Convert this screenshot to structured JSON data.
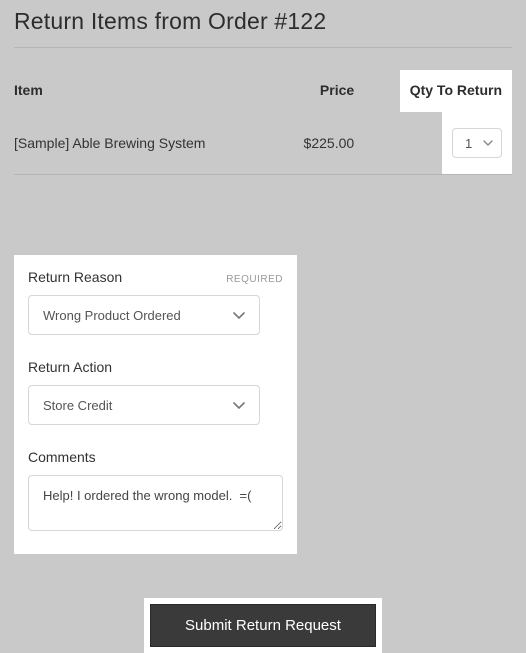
{
  "page": {
    "title": "Return Items from Order #122"
  },
  "table": {
    "headers": {
      "item": "Item",
      "price": "Price",
      "qty": "Qty To Return"
    },
    "rows": [
      {
        "name": "[Sample] Able Brewing System",
        "price": "$225.00",
        "qty": "1"
      }
    ]
  },
  "form": {
    "reason": {
      "label": "Return Reason",
      "required": "REQUIRED",
      "value": "Wrong Product Ordered"
    },
    "action": {
      "label": "Return Action",
      "value": "Store Credit"
    },
    "comments": {
      "label": "Comments",
      "value": "Help! I ordered the wrong model.  =("
    },
    "submit": "Submit Return Request"
  }
}
